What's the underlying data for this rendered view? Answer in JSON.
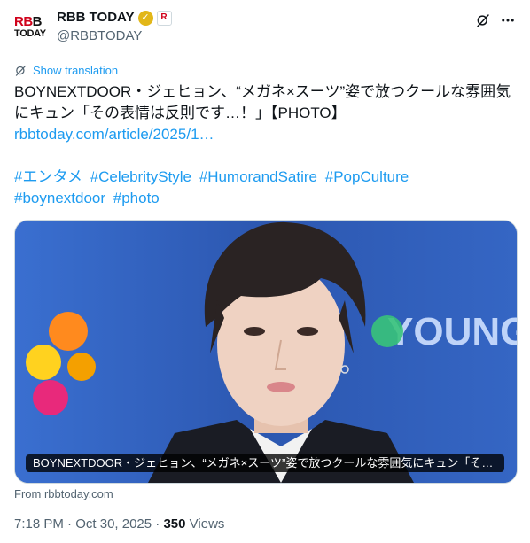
{
  "account": {
    "avatar_top_red": "RB",
    "avatar_top_black": "B",
    "avatar_bottom": "TODAY",
    "display_name": "RBB TODAY",
    "handle": "@RBBTODAY",
    "affiliate_badge": "R",
    "verified_icon": "verified-badge-icon",
    "verified_color": "#e2b719"
  },
  "actions": {
    "grok_icon": "grok-icon",
    "more_icon": "more-icon"
  },
  "translation": {
    "label": "Show translation"
  },
  "tweet": {
    "line1": "BOYNEXTDOOR・ジェヒョン、“メガネ×スーツ”姿で放つクールな雰囲気",
    "line2": "にキュン「その表情は反則です…！」【PHOTO】",
    "link": "rbbtoday.com/article/2025/1…",
    "hashtags_line1": [
      "#エンタメ",
      "#CelebrityStyle",
      "#HumorandSatire",
      "#PopCulture"
    ],
    "hashtags_line2": [
      "#boynextdoor",
      "#photo"
    ]
  },
  "media": {
    "caption": "BOYNEXTDOOR・ジェヒョン、“メガネ×スーツ”姿で放つクールな雰囲気にキュン「そ…",
    "backdrop_text": "YOUNG",
    "source": "From rbbtoday.com"
  },
  "meta": {
    "time": "7:18 PM",
    "date": "Oct 30, 2025",
    "views_count": "350",
    "views_label": "Views"
  },
  "colors": {
    "link": "#1d9bf0",
    "secondary": "#536471",
    "text": "#0f1419",
    "backdrop": "#2f5fb8"
  }
}
